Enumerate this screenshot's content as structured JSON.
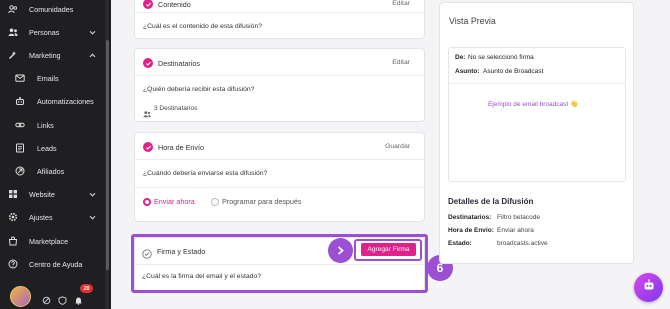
{
  "sidebar": {
    "items": [
      {
        "label": "Comunidades",
        "icon": "community-icon"
      },
      {
        "label": "Personas",
        "icon": "people-icon"
      },
      {
        "label": "Marketing",
        "icon": "marketing-icon"
      },
      {
        "label": "Emails",
        "icon": "mail-icon"
      },
      {
        "label": "Automatizaciones",
        "icon": "automation-icon"
      },
      {
        "label": "Links",
        "icon": "link-icon"
      },
      {
        "label": "Leads",
        "icon": "leads-icon"
      },
      {
        "label": "Afiliados",
        "icon": "affiliate-icon"
      },
      {
        "label": "Website",
        "icon": "website-icon"
      },
      {
        "label": "Ajustes",
        "icon": "settings-icon"
      },
      {
        "label": "Marketplace",
        "icon": "store-icon"
      },
      {
        "label": "Centro de Ayuda",
        "icon": "help-icon"
      }
    ],
    "notification_count": "20"
  },
  "content_card": {
    "title": "Contenido",
    "action": "Editar",
    "question": "¿Cuál es el contenido de esta difusión?"
  },
  "recipients_card": {
    "title": "Destinatarios",
    "action": "Editar",
    "question": "¿Quién debería recibir esta difusión?",
    "count": "3 Destinatarios"
  },
  "time_card": {
    "title": "Hora de Envío",
    "action": "Guardar",
    "question": "¿Cuándo debería enviarse esta difusión?",
    "option_now": "Enviar ahora",
    "option_later": "Programar para después"
  },
  "signature_card": {
    "title": "Firma y Estado",
    "button": "Agregar Firma",
    "question": "¿Cuál es la firma del email y el estado?"
  },
  "annotation": {
    "step": "6"
  },
  "preview": {
    "title": "Vista Previa",
    "from_label": "De:",
    "from_value": "No se seleccionó firma",
    "subject_label": "Asunto:",
    "subject_value": "Asunto de Broadcast",
    "example_text": "Ejemplo de email broadcast 👋",
    "details_title": "Detalles de la Difusión",
    "recipients_label": "Destinatarios:",
    "recipients_value": "Filtro betacode",
    "time_label": "Hora de Envío:",
    "time_value": "Enviar ahora",
    "status_label": "Estado:",
    "status_value": "broadcasts.active"
  },
  "colors": {
    "accent": "#e0218a",
    "highlight": "#9b4fd3",
    "sidebar_bg": "#1f1f22"
  }
}
